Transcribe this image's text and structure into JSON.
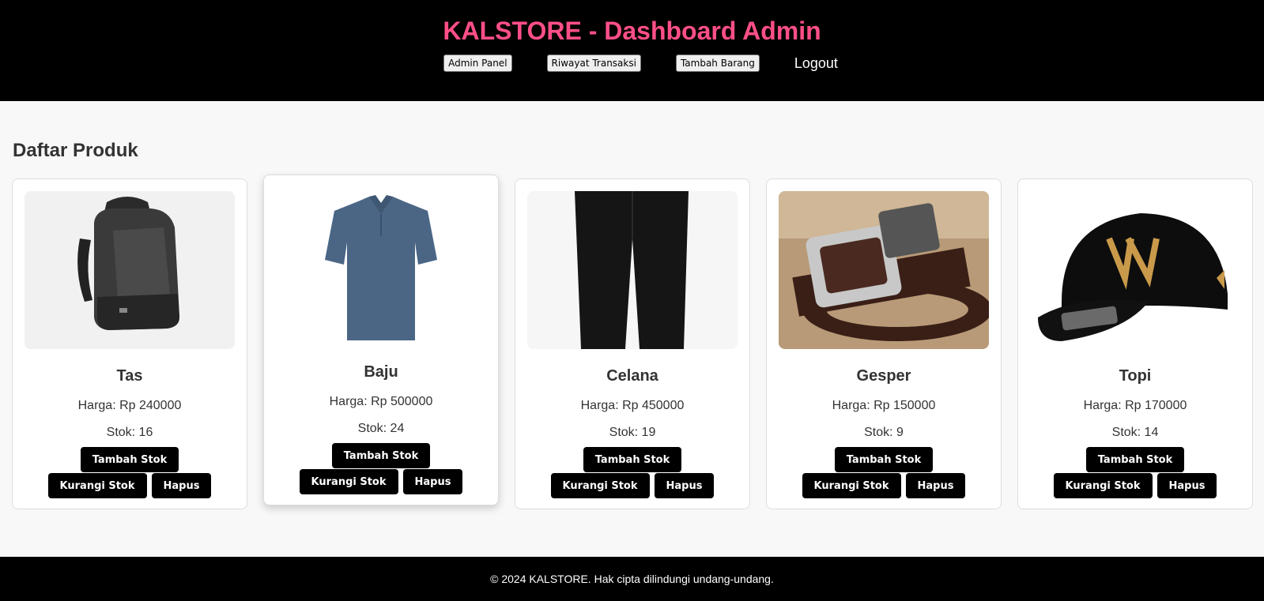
{
  "header": {
    "title": "KALSTORE - Dashboard Admin",
    "nav": {
      "admin_panel": "Admin Panel",
      "riwayat_transaksi": "Riwayat Transaksi",
      "tambah_barang": "Tambah Barang",
      "logout": "Logout"
    }
  },
  "main": {
    "section_title": "Daftar Produk",
    "products": [
      {
        "name": "Tas",
        "price": "Harga: Rp 240000",
        "stock": "Stok: 16",
        "image": "backpack-image"
      },
      {
        "name": "Baju",
        "price": "Harga: Rp 500000",
        "stock": "Stok: 24",
        "image": "polo-shirt-image"
      },
      {
        "name": "Celana",
        "price": "Harga: Rp 450000",
        "stock": "Stok: 19",
        "image": "trousers-image"
      },
      {
        "name": "Gesper",
        "price": "Harga: Rp 150000",
        "stock": "Stok: 9",
        "image": "belt-image"
      },
      {
        "name": "Topi",
        "price": "Harga: Rp 170000",
        "stock": "Stok: 14",
        "image": "cap-image"
      }
    ],
    "actions": {
      "add_stock": "Tambah Stok",
      "reduce_stock": "Kurangi Stok",
      "delete": "Hapus"
    }
  },
  "footer": {
    "text": "© 2024 KALSTORE. Hak cipta dilindungi undang-undang."
  },
  "colors": {
    "header_bg": "#000000",
    "title_accent": "#ff4f87",
    "button_bg": "#000000",
    "page_bg": "#f8f8f8"
  }
}
